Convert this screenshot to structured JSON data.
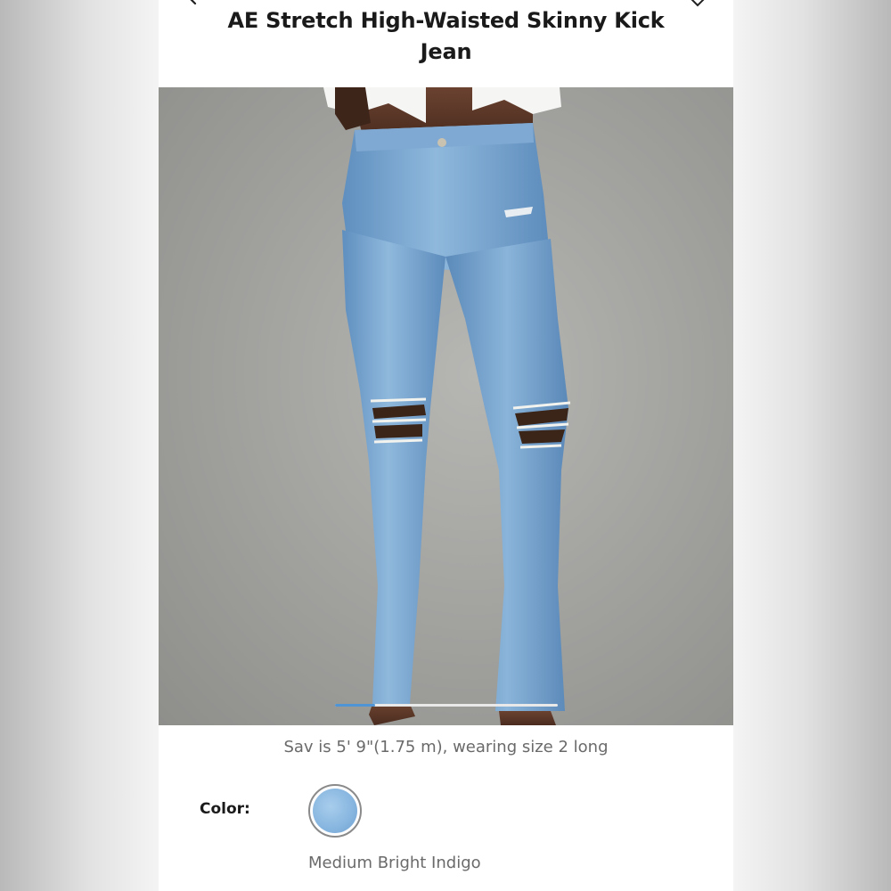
{
  "product": {
    "title": "AE Stretch High-Waisted Skinny Kick Jean"
  },
  "carousel": {
    "progress": 0.18
  },
  "model_info": "Sav is 5' 9\"(1.75 m), wearing size 2 long",
  "color": {
    "label": "Color:",
    "selected_name": "Medium Bright Indigo",
    "swatch_hex": "#86b5df"
  },
  "icons": {
    "back": "chevron-left-icon",
    "favorite": "heart-icon"
  },
  "colors": {
    "accent": "#4f94d4",
    "background": "#f4f4f4",
    "card": "#ffffff",
    "text_primary": "#1a1a1a",
    "text_secondary": "#6a6a6a"
  }
}
